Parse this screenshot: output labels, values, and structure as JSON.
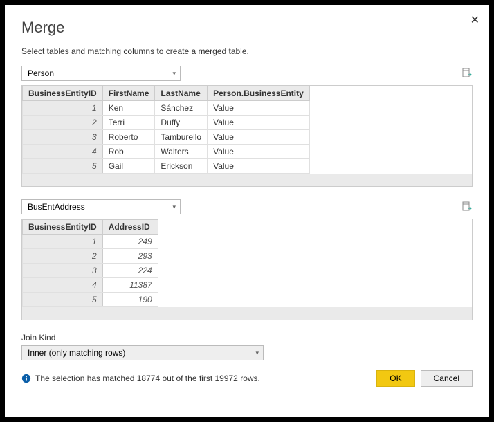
{
  "dialog": {
    "title": "Merge",
    "subtitle": "Select tables and matching columns to create a merged table."
  },
  "table1": {
    "selected": "Person",
    "headers": [
      "BusinessEntityID",
      "FirstName",
      "LastName",
      "Person.BusinessEntity"
    ],
    "rows": [
      {
        "id": "1",
        "first": "Ken",
        "last": "Sánchez",
        "be": "Value"
      },
      {
        "id": "2",
        "first": "Terri",
        "last": "Duffy",
        "be": "Value"
      },
      {
        "id": "3",
        "first": "Roberto",
        "last": "Tamburello",
        "be": "Value"
      },
      {
        "id": "4",
        "first": "Rob",
        "last": "Walters",
        "be": "Value"
      },
      {
        "id": "5",
        "first": "Gail",
        "last": "Erickson",
        "be": "Value"
      }
    ]
  },
  "table2": {
    "selected": "BusEntAddress",
    "headers": [
      "BusinessEntityID",
      "AddressID"
    ],
    "rows": [
      {
        "id": "1",
        "addr": "249"
      },
      {
        "id": "2",
        "addr": "293"
      },
      {
        "id": "3",
        "addr": "224"
      },
      {
        "id": "4",
        "addr": "11387"
      },
      {
        "id": "5",
        "addr": "190"
      }
    ]
  },
  "join": {
    "label": "Join Kind",
    "selected": "Inner (only matching rows)"
  },
  "status": "The selection has matched 18774 out of the first 19972 rows.",
  "buttons": {
    "ok": "OK",
    "cancel": "Cancel"
  }
}
